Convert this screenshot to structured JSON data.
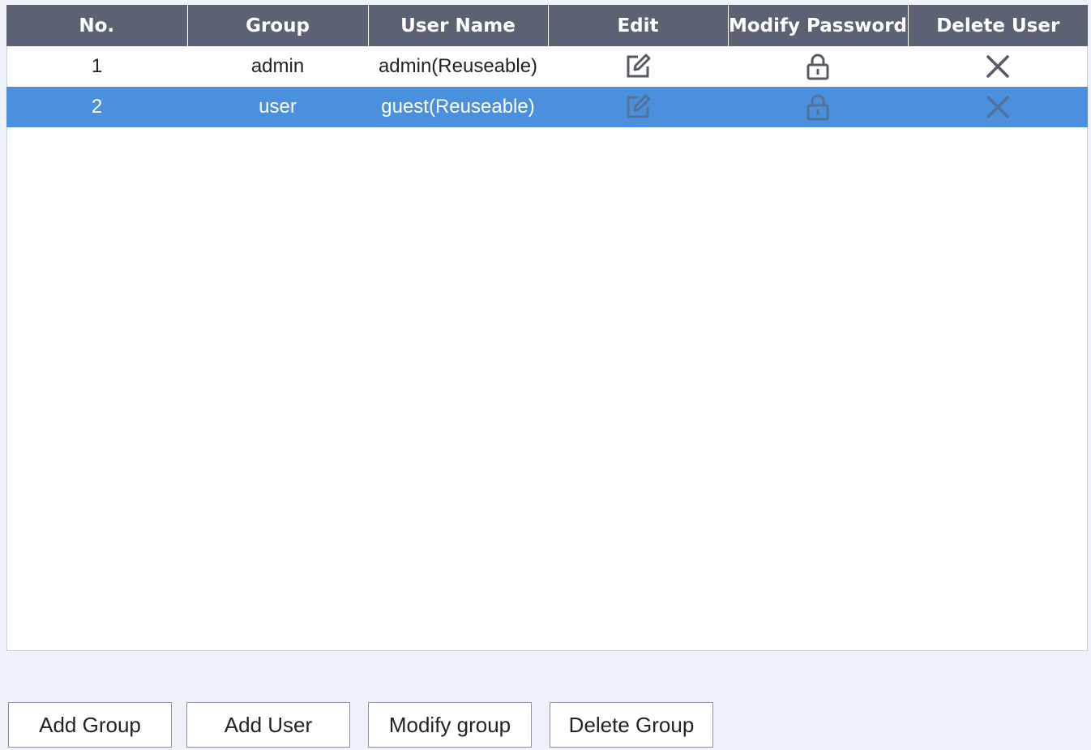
{
  "table": {
    "columns": [
      "No.",
      "Group",
      "User Name",
      "Edit",
      "Modify Password",
      "Delete User"
    ],
    "rows": [
      {
        "no": "1",
        "group": "admin",
        "user_name": "admin(Reuseable)",
        "selected": false
      },
      {
        "no": "2",
        "group": "user",
        "user_name": "guest(Reuseable)",
        "selected": true
      }
    ]
  },
  "buttons": {
    "add_group": "Add Group",
    "add_user": "Add User",
    "modify_group": "Modify group",
    "delete_group": "Delete Group"
  },
  "icons": {
    "edit": "edit-icon",
    "modify_password": "lock-icon",
    "delete_user": "close-icon"
  },
  "colors": {
    "header_bg": "#5b6273",
    "selected_row": "#4a90dd",
    "page_bg": "#eef1f7"
  }
}
